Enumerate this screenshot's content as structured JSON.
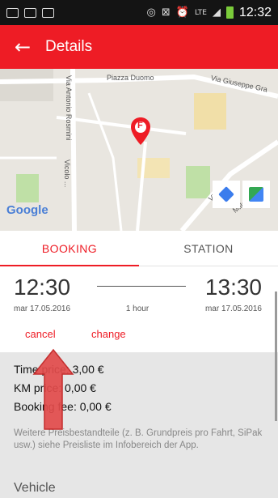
{
  "status_bar": {
    "time": "12:32",
    "network": "LTE",
    "icons": [
      "image-icon",
      "bbm-icon",
      "message-icon",
      "vibrate-icon",
      "mute-icon",
      "alarm-icon",
      "lte-icon",
      "signal-icon",
      "battery-icon"
    ]
  },
  "app_bar": {
    "title": "Details",
    "back_icon": "arrow-left-icon"
  },
  "map": {
    "streets": [
      "Piazza Duomo",
      "Via Giuseppe Gra",
      "Via Antonio Rosmini",
      "Vicolo ...",
      "Via Paris",
      "Mille"
    ],
    "google_logo": "Google",
    "pin_letter": "F",
    "pin_color": "#ee1c25",
    "buttons": [
      "directions-icon",
      "google-maps-icon"
    ]
  },
  "tabs": [
    {
      "label": "BOOKING",
      "active": true
    },
    {
      "label": "STATION",
      "active": false
    }
  ],
  "booking": {
    "start_time": "12:30",
    "start_date": "mar 17.05.2016",
    "duration": "1 hour",
    "end_time": "13:30",
    "end_date": "mar 17.05.2016",
    "cancel_label": "cancel",
    "change_label": "change"
  },
  "prices": {
    "time_price": "Time price: 3,00 €",
    "km_price": "KM price: 0,00 €",
    "booking_fee": "Booking fee: 0,00 €",
    "note": "Weitere Preisbestandteile (z. B. Grundpreis pro Fahrt, SiPak usw.) siehe Preisliste im Infobereich der App."
  },
  "vehicle_heading": "Vehicle",
  "colors": {
    "accent": "#ee1c25",
    "status_bar": "#141414",
    "price_bg": "#e6e6e6"
  }
}
